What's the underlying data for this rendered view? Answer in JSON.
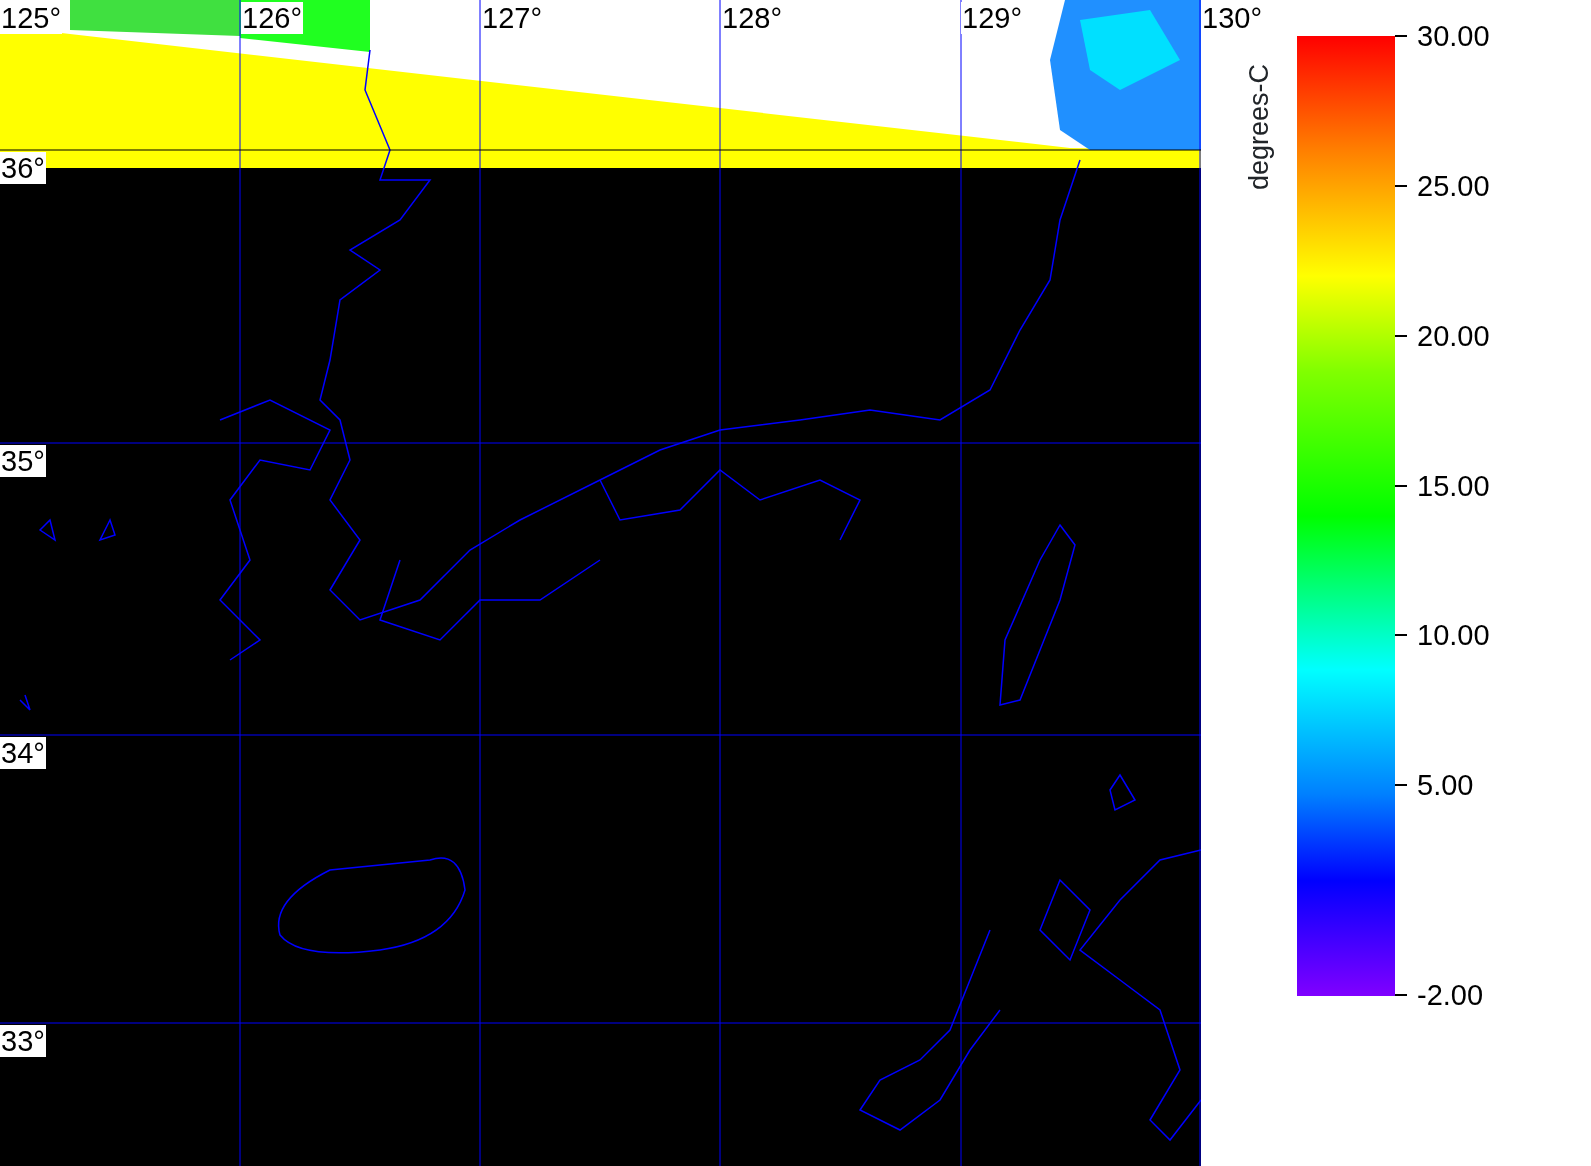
{
  "map": {
    "lon_labels": [
      "125°",
      "126°",
      "127°",
      "128°",
      "129°",
      "130°"
    ],
    "lat_labels": [
      "36°",
      "35°",
      "34°",
      "33°"
    ]
  },
  "colorbar": {
    "title": "degrees-C",
    "ticks": [
      {
        "label": "30.00"
      },
      {
        "label": "25.00"
      },
      {
        "label": "20.00"
      },
      {
        "label": "15.00"
      },
      {
        "label": "10.00"
      },
      {
        "label": "5.00"
      },
      {
        "label": "-2.00"
      }
    ]
  }
}
